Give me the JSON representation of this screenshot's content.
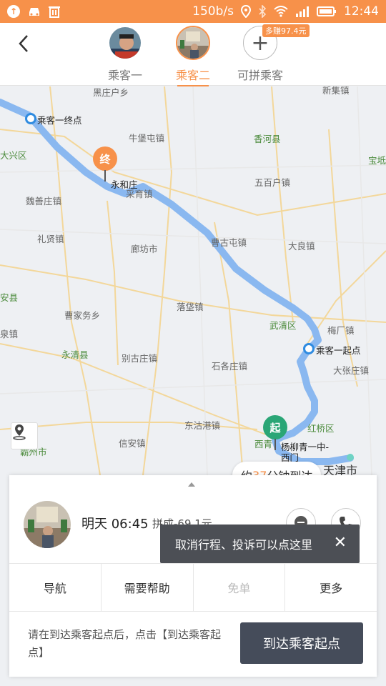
{
  "status_bar": {
    "speed": "150b/s",
    "time": "12:44",
    "icons": [
      "upload-icon",
      "car-icon",
      "trash-icon",
      "location-icon",
      "bluetooth-icon",
      "wifi-icon",
      "signal-icon",
      "battery-icon"
    ]
  },
  "header": {
    "tabs": [
      {
        "label": "乘客一",
        "active": false
      },
      {
        "label": "乘客二",
        "active": true
      },
      {
        "label": "可拼乘客",
        "active": false
      }
    ],
    "extra_badge": "多赚97.4元"
  },
  "map": {
    "places": [
      {
        "name": "黑庄户乡",
        "style": ""
      },
      {
        "name": "新集镇",
        "style": ""
      },
      {
        "name": "乘客一终点",
        "style": "dark"
      },
      {
        "name": "大兴区",
        "style": "green"
      },
      {
        "name": "牛堡屯镇",
        "style": ""
      },
      {
        "name": "香河县",
        "style": "green"
      },
      {
        "name": "宝坻",
        "style": "green"
      },
      {
        "name": "魏善庄镇",
        "style": ""
      },
      {
        "name": "五百户镇",
        "style": ""
      },
      {
        "name": "永和庄",
        "style": "dark"
      },
      {
        "name": "采育镇",
        "style": ""
      },
      {
        "name": "礼贤镇",
        "style": ""
      },
      {
        "name": "曹古屯镇",
        "style": ""
      },
      {
        "name": "廊坊市",
        "style": ""
      },
      {
        "name": "大良镇",
        "style": ""
      },
      {
        "name": "安县",
        "style": "green"
      },
      {
        "name": "曹家务乡",
        "style": ""
      },
      {
        "name": "落垡镇",
        "style": ""
      },
      {
        "name": "武清区",
        "style": "green"
      },
      {
        "name": "梅厂镇",
        "style": ""
      },
      {
        "name": "泉镇",
        "style": ""
      },
      {
        "name": "永清县",
        "style": "green"
      },
      {
        "name": "别古庄镇",
        "style": ""
      },
      {
        "name": "石各庄镇",
        "style": ""
      },
      {
        "name": "乘客一起点",
        "style": "dark"
      },
      {
        "name": "大张庄镇",
        "style": ""
      },
      {
        "name": "东沽港镇",
        "style": ""
      },
      {
        "name": "信安镇",
        "style": ""
      },
      {
        "name": "红桥区",
        "style": "green"
      },
      {
        "name": "西青",
        "style": "green"
      },
      {
        "name": "杨柳青一中-",
        "style": "dark"
      },
      {
        "name": "西门",
        "style": "dark"
      },
      {
        "name": "天津市",
        "style": "big"
      },
      {
        "name": "霸州市",
        "style": "green"
      }
    ],
    "end_pin": "终",
    "start_pin": "起",
    "eta": {
      "prefix": "约",
      "minutes": "37",
      "suffix": "分钟到达"
    },
    "route_color": "#8ab8f0",
    "accent": "#f7914a",
    "start_pin_color": "#2aa676"
  },
  "card": {
    "time": "明天 06:45",
    "price": "拼成-69.1元",
    "tooltip": "取消行程、投诉可以点这里",
    "actions": [
      {
        "label": "导航",
        "disabled": false
      },
      {
        "label": "需要帮助",
        "disabled": false
      },
      {
        "label": "免单",
        "disabled": true
      },
      {
        "label": "更多",
        "disabled": false
      }
    ],
    "hint": "请在到达乘客起点后，点击【到达乘客起点】",
    "arrive_button": "到达乘客起点"
  }
}
